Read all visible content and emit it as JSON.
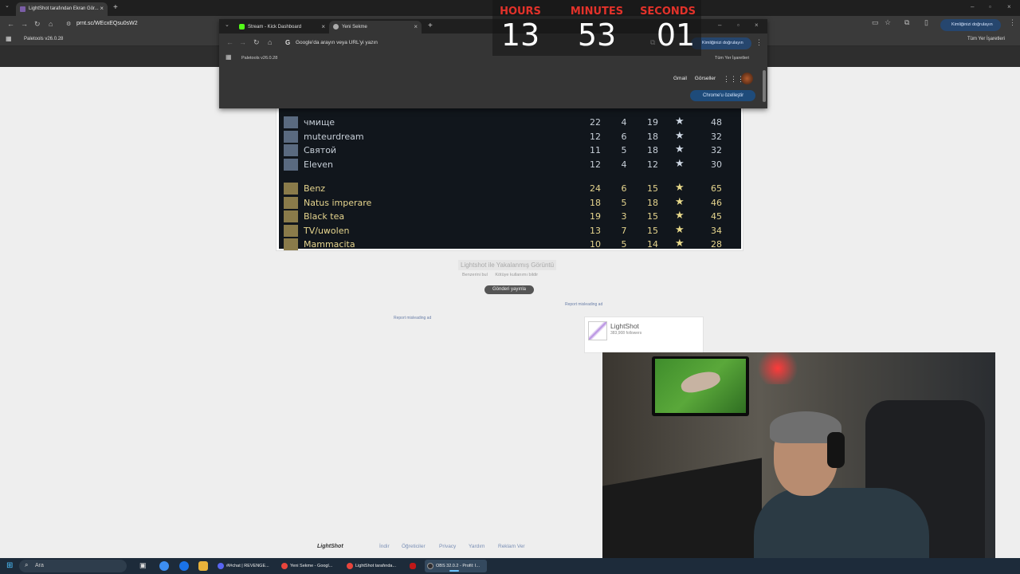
{
  "back_browser": {
    "tab_title": "LightShot tarafından Ekran Gör...",
    "url": "prnt.sc/WEcxEQsu0sW2",
    "bookmark": "Paletools v26.0.28",
    "verify_label": "Kimliğinizi doğrulayın",
    "all_bookmarks": "Tüm Yer İşaretleri"
  },
  "front_browser": {
    "tabs": [
      {
        "label": "Stream - Kick Dashboard",
        "color": "#53fc18"
      },
      {
        "label": "Yeni Sekme",
        "color": "#aaaaaa"
      }
    ],
    "omnibox_placeholder": "Google'da arayın veya URL'yi yazın",
    "bookmark": "Paletools v26.0.28",
    "verify_label": "Kimliğinizi doğrulayın",
    "all_bookmarks": "Tüm Yer İşaretleri",
    "gmail": "Gmail",
    "images": "Görseller",
    "customize": "Chrome'u özelleştir"
  },
  "timer": {
    "hours_label": "HOURS",
    "hours": "13",
    "minutes_label": "MINUTES",
    "minutes": "53",
    "seconds_label": "SECONDS",
    "seconds": "01"
  },
  "scoreboard": {
    "enemy": [
      {
        "name": "чмище",
        "k": "22",
        "a": "4",
        "d": "19",
        "score": "48"
      },
      {
        "name": "muteurdream",
        "k": "12",
        "a": "6",
        "d": "18",
        "score": "32"
      },
      {
        "name": "Святой",
        "k": "11",
        "a": "5",
        "d": "18",
        "score": "32"
      },
      {
        "name": "Eleven",
        "k": "12",
        "a": "4",
        "d": "12",
        "score": "30"
      }
    ],
    "ally": [
      {
        "name": "Benz",
        "k": "24",
        "a": "6",
        "d": "15",
        "score": "65"
      },
      {
        "name": "Natus imperare",
        "k": "18",
        "a": "5",
        "d": "18",
        "score": "46"
      },
      {
        "name": "Black tea",
        "k": "19",
        "a": "3",
        "d": "15",
        "score": "45"
      },
      {
        "name": "TV/uwolen",
        "k": "13",
        "a": "7",
        "d": "15",
        "score": "34"
      },
      {
        "name": "Mammacita",
        "k": "10",
        "a": "5",
        "d": "14",
        "score": "28"
      }
    ]
  },
  "page": {
    "caption": "Lightshot ile Yakalanmış Görüntü",
    "similar": "Benzerini bul",
    "copyright": "Kötüye kullanımı bildir",
    "share": "Gönderi yayınla",
    "report_ad": "Report misleading ad",
    "widget_name": "LightShot",
    "widget_followers": "383,908 followers"
  },
  "footer": {
    "brand": "LightShot",
    "links": [
      "İndir",
      "Öğreticiler",
      "Privacy",
      "Yardım",
      "Reklam Ver"
    ]
  },
  "taskbar": {
    "search": "Ara",
    "apps": [
      {
        "label": "#l#chat | REVENGE...",
        "color": "#5865f2"
      },
      {
        "label": "Yeni Sekme - Googl...",
        "color": "#e8453c"
      },
      {
        "label": "LightShot tarafında...",
        "color": "#e8453c"
      },
      {
        "label": "OBS 32.0.2 - Profil: I...",
        "color": "#302e31"
      }
    ]
  }
}
